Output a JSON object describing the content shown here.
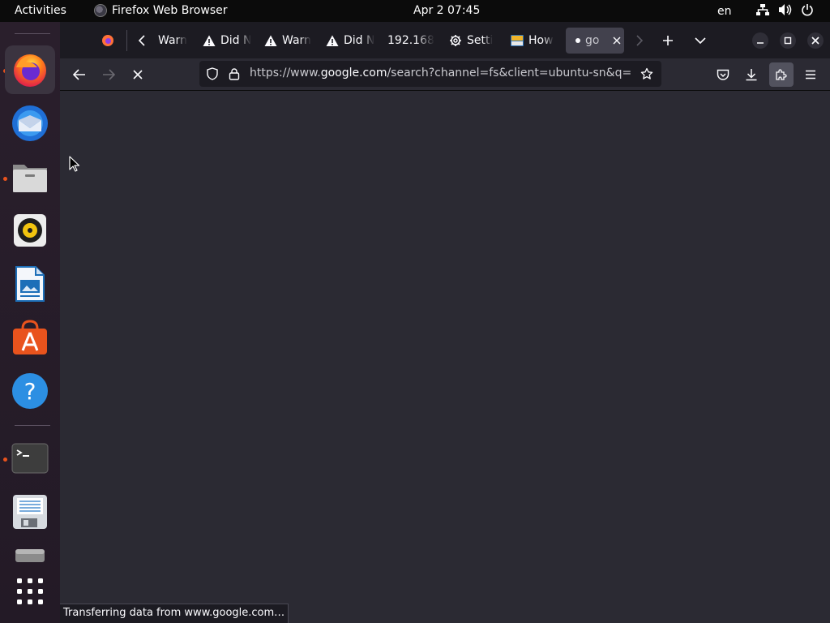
{
  "topbar": {
    "activities": "Activities",
    "app_name": "Firefox Web Browser",
    "clock": "Apr 2  07:45",
    "lang": "en",
    "tray_icons": [
      "network-icon",
      "volume-icon",
      "power-icon"
    ]
  },
  "dock": {
    "items": [
      {
        "name": "firefox",
        "icon": "firefox-icon",
        "running": true
      },
      {
        "name": "thunderbird",
        "icon": "thunderbird-icon",
        "running": false
      },
      {
        "name": "files",
        "icon": "files-icon",
        "running": true
      },
      {
        "name": "rhythmbox",
        "icon": "rhythmbox-icon",
        "running": false
      },
      {
        "name": "writer",
        "icon": "libreoffice-writer-icon",
        "running": false
      },
      {
        "name": "app-center",
        "icon": "app-center-icon",
        "running": false
      },
      {
        "name": "help",
        "icon": "help-icon",
        "running": false
      },
      {
        "name": "terminal",
        "icon": "terminal-icon",
        "running": true
      },
      {
        "name": "save",
        "icon": "floppy-icon",
        "running": false
      },
      {
        "name": "drive",
        "icon": "drive-icon",
        "running": false
      },
      {
        "name": "app-grid",
        "icon": "app-grid-icon",
        "running": false
      }
    ]
  },
  "firefox": {
    "tabs": [
      {
        "label": "Warn",
        "icon": "warning-icon"
      },
      {
        "label": "Did N",
        "icon": "warning-icon"
      },
      {
        "label": "Warn",
        "icon": "warning-icon"
      },
      {
        "label": "Did N",
        "icon": "warning-icon"
      },
      {
        "label": "192.168",
        "icon": ""
      },
      {
        "label": "Setti",
        "icon": "gear-icon"
      },
      {
        "label": "How",
        "icon": "foss-linux-icon"
      },
      {
        "label": "go",
        "icon": "loading-icon",
        "selected": true
      }
    ],
    "url": {
      "prefix": "https://www.",
      "host": "google.com",
      "rest": "/search?channel=fs&client=ubuntu-sn&q=d"
    },
    "status": "Transferring data from www.google.com…",
    "accent": "#e9531d"
  }
}
